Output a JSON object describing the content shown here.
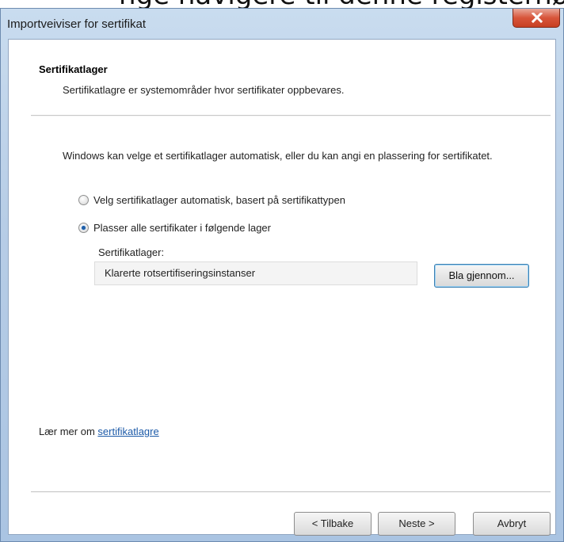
{
  "top_fragment": "nge navigere til denne registernøkkelen",
  "window": {
    "title": "Importveiviser for sertifikat"
  },
  "header": {
    "title": "Sertifikatlager",
    "subtitle": "Sertifikatlagre er systemområder hvor sertifikater oppbevares."
  },
  "intro_text": "Windows kan velge et sertifikatlager automatisk, eller du kan angi en plassering for sertifikatet.",
  "options": [
    {
      "label": "Velg sertifikatlager automatisk, basert på sertifikattypen",
      "selected": false
    },
    {
      "label": "Plasser alle sertifikater i følgende lager",
      "selected": true
    }
  ],
  "store": {
    "label": "Sertifikatlager:",
    "value": "Klarerte rotsertifiseringsinstanser",
    "browse_label": "Bla gjennom..."
  },
  "learn_more": {
    "prefix": "Lær mer om ",
    "link": "sertifikatlagre"
  },
  "buttons": {
    "back": "< Tilbake",
    "next": "Neste >",
    "cancel": "Avbryt"
  }
}
